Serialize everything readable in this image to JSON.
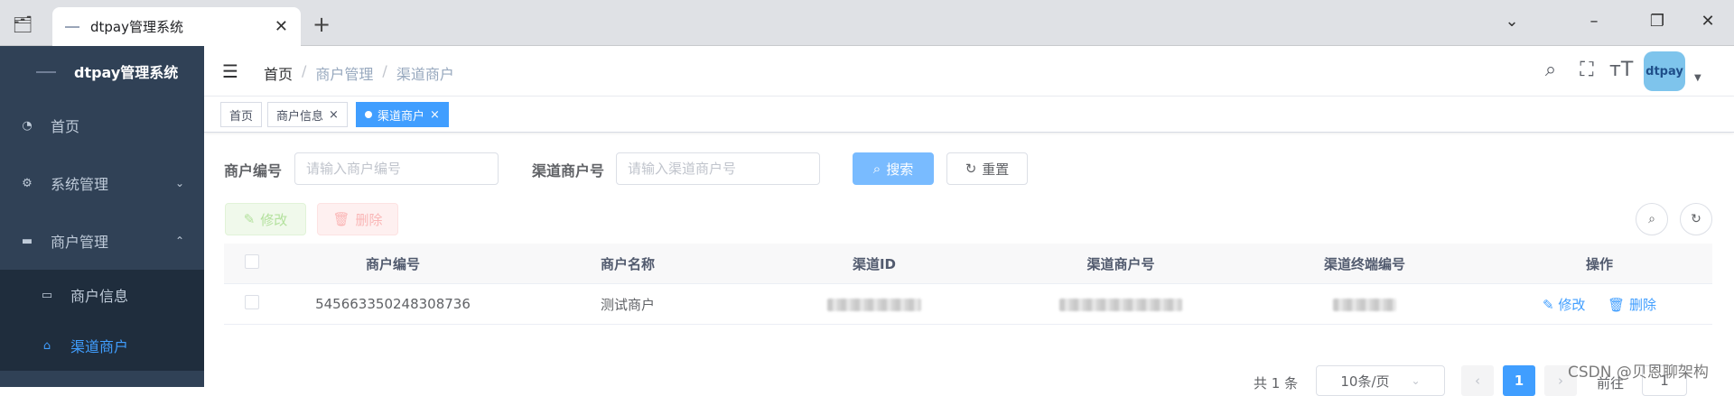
{
  "browser": {
    "tab_title": "dtpay管理系统",
    "tab_close": "✕",
    "new_tab": "+"
  },
  "sidebar": {
    "logo_text": "dtpay管理系统",
    "items": [
      {
        "label": "首页",
        "icon": "dashboard-icon"
      },
      {
        "label": "系统管理",
        "icon": "gear-icon",
        "arrow": "⌄"
      },
      {
        "label": "商户管理",
        "icon": "shop-icon",
        "arrow": "⌃"
      }
    ],
    "submenu": [
      {
        "label": "商户信息",
        "icon": "image-icon"
      },
      {
        "label": "渠道商户",
        "icon": "store-icon",
        "active": true
      }
    ]
  },
  "navbar": {
    "breadcrumb": [
      "首页",
      "商户管理",
      "渠道商户"
    ],
    "avatar_text": "dtpay"
  },
  "tags": [
    {
      "label": "首页"
    },
    {
      "label": "商户信息",
      "close": "×"
    },
    {
      "label": "渠道商户",
      "close": "×",
      "active": true
    }
  ],
  "search": {
    "merchant_no_label": "商户编号",
    "merchant_no_placeholder": "请输入商户编号",
    "channel_merchant_label": "渠道商户号",
    "channel_merchant_placeholder": "请输入渠道商户号",
    "search_button": "搜索",
    "reset_button": "重置"
  },
  "toolbar": {
    "edit_button": "修改",
    "delete_button": "删除"
  },
  "table": {
    "columns": [
      "商户编号",
      "商户名称",
      "渠道ID",
      "渠道商户号",
      "渠道终端编号",
      "操作"
    ],
    "rows": [
      {
        "merchant_no": "545663350248308736",
        "merchant_name": "测试商户",
        "edit": "修改",
        "delete": "删除"
      }
    ]
  },
  "pagination": {
    "total": "共 1 条",
    "page_size": "10条/页",
    "current_page": "1",
    "goto_label": "前往",
    "goto_value": "1"
  },
  "watermark": "CSDN @贝恩聊架构",
  "colors": {
    "sidebar_bg": "#304156",
    "accent": "#409eff"
  }
}
